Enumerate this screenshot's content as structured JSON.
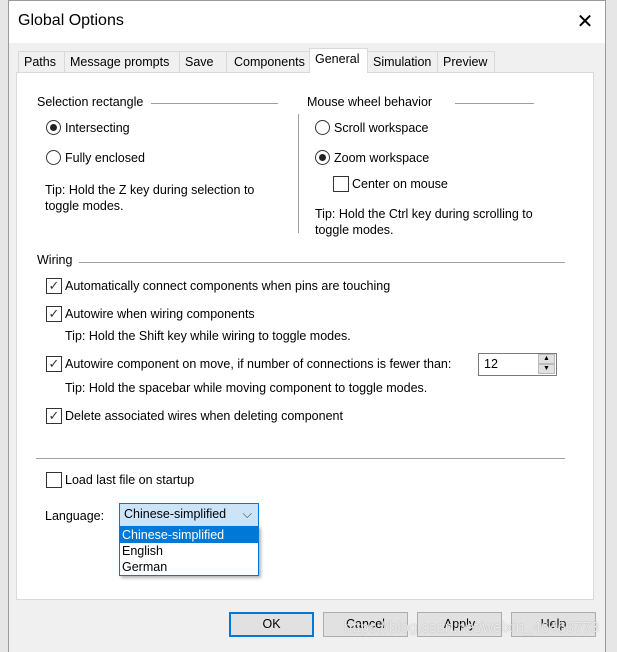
{
  "window": {
    "title": "Global Options"
  },
  "tabs": [
    {
      "label": "Paths"
    },
    {
      "label": "Message prompts"
    },
    {
      "label": "Save"
    },
    {
      "label": "Components"
    },
    {
      "label": "General",
      "active": true
    },
    {
      "label": "Simulation"
    },
    {
      "label": "Preview"
    }
  ],
  "selection": {
    "heading": "Selection rectangle",
    "options": [
      {
        "label": "Intersecting",
        "selected": true
      },
      {
        "label": "Fully enclosed",
        "selected": false
      }
    ],
    "tip_lines": [
      "Tip: Hold the Z key during selection to",
      "toggle modes."
    ]
  },
  "mouse": {
    "heading": "Mouse wheel behavior",
    "options": [
      {
        "label": "Scroll workspace",
        "selected": false
      },
      {
        "label": "Zoom workspace",
        "selected": true
      }
    ],
    "center_on_mouse": {
      "label": "Center on mouse",
      "checked": false
    },
    "tip_lines": [
      "Tip: Hold the Ctrl key during scrolling to",
      "toggle modes."
    ]
  },
  "wiring": {
    "heading": "Wiring",
    "items": [
      {
        "label": "Automatically connect components when pins are touching",
        "checked": true
      },
      {
        "label": "Autowire when wiring components",
        "checked": true,
        "tip": "Tip: Hold the Shift key while wiring to toggle modes."
      },
      {
        "label": "Autowire component on move, if number of connections is fewer than:",
        "checked": true,
        "tip": "Tip: Hold the spacebar while moving component to toggle modes."
      },
      {
        "label": "Delete associated wires when deleting component",
        "checked": true
      }
    ],
    "connections_limit": "12"
  },
  "load_last": {
    "label": "Load last file on startup",
    "checked": false
  },
  "language": {
    "label": "Language:",
    "value": "Chinese-simplified",
    "options": [
      "Chinese-simplified",
      "English",
      "German"
    ]
  },
  "buttons": {
    "ok": "OK",
    "cancel": "Cancel",
    "apply": "Apply",
    "help": "Help"
  },
  "watermark": "https://blog.csdn.net/weixin_46463773",
  "colors": {
    "accent": "#0078d7"
  }
}
